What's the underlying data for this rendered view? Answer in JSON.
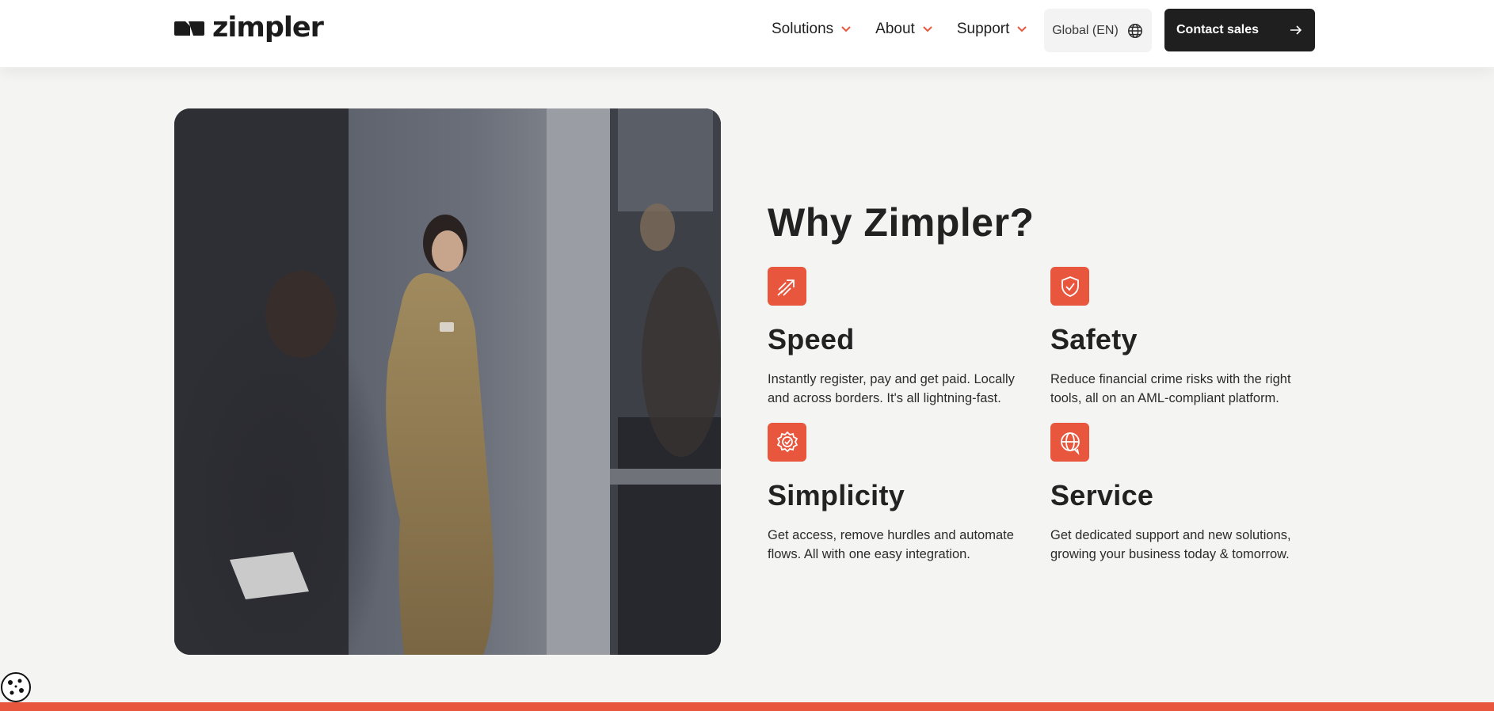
{
  "header": {
    "logo_text": "zimpler",
    "nav": [
      {
        "label": "Solutions"
      },
      {
        "label": "About"
      },
      {
        "label": "Support"
      }
    ],
    "language_label": "Global (EN)",
    "cta_label": "Contact sales"
  },
  "section": {
    "title": "Why Zimpler?",
    "features": [
      {
        "title": "Speed",
        "description": "Instantly register, pay and get paid. Locally and across borders. It's all lightning-fast.",
        "icon": "speed-arrow-icon"
      },
      {
        "title": "Safety",
        "description": "Reduce financial crime risks with the right tools, all on an AML-compliant platform.",
        "icon": "shield-check-icon"
      },
      {
        "title": "Simplicity",
        "description": "Get access, remove hurdles and automate flows. All with one easy integration.",
        "icon": "badge-check-icon"
      },
      {
        "title": "Service",
        "description": "Get dedicated support and new solutions, growing your business today & tomorrow.",
        "icon": "globe-chat-icon"
      }
    ]
  },
  "colors": {
    "accent": "#e8563e",
    "dark": "#1f1f1f",
    "background": "#f4f4f3"
  }
}
